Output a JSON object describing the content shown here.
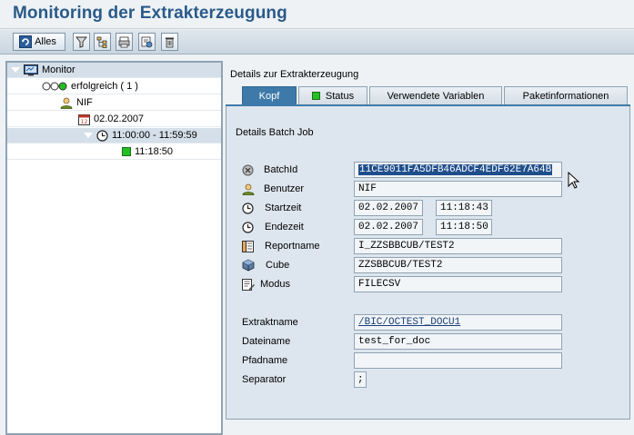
{
  "window": {
    "title": "Monitoring der Extrakterzeugung"
  },
  "toolbar": {
    "all_label": "Alles",
    "buttons": [
      "refresh-icon",
      "filter-icon",
      "hierarchy-icon",
      "print-icon",
      "settings-icon",
      "delete-icon"
    ]
  },
  "tree": {
    "nodes": [
      {
        "label": "Monitor",
        "icon": "monitor-icon"
      },
      {
        "label": "erfolgreich ( 1 )",
        "icon": "status-lights-icon"
      },
      {
        "label": "NIF",
        "icon": "user-icon"
      },
      {
        "label": "02.02.2007",
        "icon": "calendar-icon"
      },
      {
        "label": "11:00:00 - 11:59:59",
        "icon": "clock-icon"
      },
      {
        "label": "11:18:50",
        "icon": "green-status-icon"
      }
    ]
  },
  "details": {
    "panel_title": "Details zur Extrakterzeugung",
    "tabs": [
      "Kopf",
      "Status",
      "Verwendete Variablen",
      "Paketinformationen"
    ],
    "active_tab": "Kopf",
    "section_title": "Details Batch Job",
    "fields": {
      "batchid_label": "BatchId",
      "batchid_value": "11CE9011FA5DFB46ADCF4EDF62E7A64B",
      "benutzer_label": "Benutzer",
      "benutzer_value": "NIF",
      "startzeit_label": "Startzeit",
      "startzeit_date": "02.02.2007",
      "startzeit_time": "11:18:43",
      "endezeit_label": "Endezeit",
      "endezeit_date": "02.02.2007",
      "endezeit_time": "11:18:50",
      "reportname_label": "Reportname",
      "reportname_value": "I_ZZSBBCUB/TEST2",
      "cube_label": "Cube",
      "cube_value": "ZZSBBCUB/TEST2",
      "modus_label": "Modus",
      "modus_value": "FILECSV",
      "extraktname_label": "Extraktname",
      "extraktname_value": "/BIC/OCTEST_DOCU1",
      "dateiname_label": "Dateiname",
      "dateiname_value": "test_for_doc",
      "pfadname_label": "Pfadname",
      "pfadname_value": "",
      "separator_label": "Separator",
      "separator_value": ";"
    }
  },
  "colors": {
    "title": "#2a5a8a",
    "active_tab": "#3d7aa9",
    "status_green": "#22c022"
  }
}
